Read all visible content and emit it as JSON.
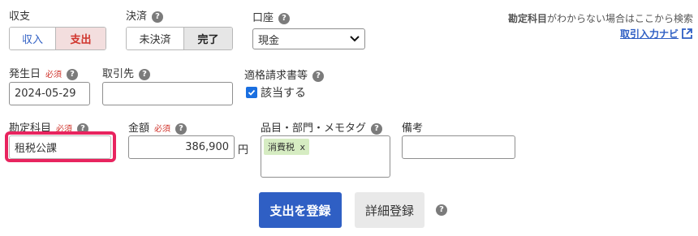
{
  "income_expense": {
    "label": "収支",
    "options": [
      "収入",
      "支出"
    ],
    "selected": "支出"
  },
  "settlement": {
    "label": "決済",
    "options": [
      "未決済",
      "完了"
    ],
    "selected": "完了"
  },
  "account": {
    "label": "口座",
    "value": "現金"
  },
  "help_link": {
    "text_bold": "勘定科目",
    "text_rest": "がわからない場合はここから検索",
    "link": "取引入力ナビ"
  },
  "issue_date": {
    "label": "発生日",
    "required": "必須",
    "value": "2024-05-29"
  },
  "partner": {
    "label": "取引先",
    "value": ""
  },
  "invoice": {
    "label": "適格請求書等",
    "checkbox_label": "該当する",
    "checked": true
  },
  "account_item": {
    "label": "勘定科目",
    "required": "必須",
    "value": "租税公課"
  },
  "amount": {
    "label": "金額",
    "required": "必須",
    "value": "386,900",
    "unit": "円"
  },
  "tags": {
    "label": "品目・部門・メモタグ",
    "items": [
      {
        "name": "消費税",
        "remove": "x"
      }
    ]
  },
  "notes": {
    "label": "備考",
    "value": ""
  },
  "buttons": {
    "register": "支出を登録",
    "detail": "詳細登録"
  },
  "help_glyph": "?",
  "colors": {
    "primary": "#2f5fc4",
    "highlight": "#e8245f",
    "tag_bg": "#d6ecc2",
    "expense_text": "#d0342c"
  }
}
